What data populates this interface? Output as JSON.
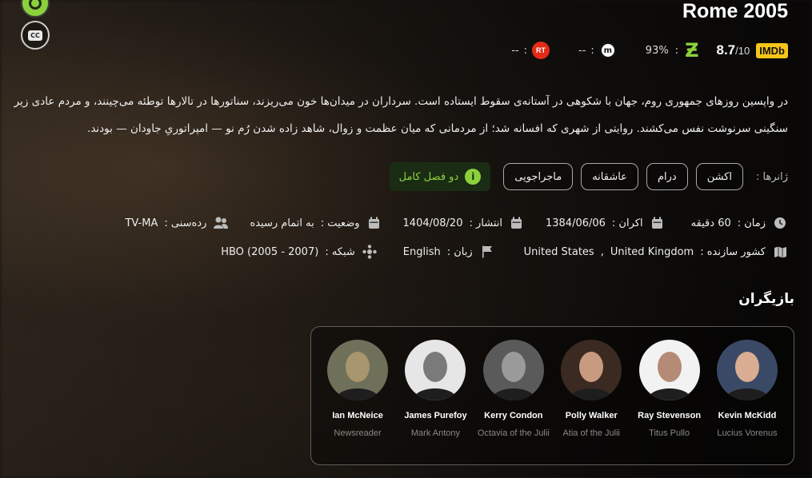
{
  "title": "Rome 2005",
  "ratings": {
    "rt_label": "RT",
    "rt_value": "--",
    "mc_value": "--",
    "pct_value": "93%",
    "imdb_score": "8.7",
    "imdb_max": "/10",
    "imdb_label": "IMDb"
  },
  "description": "در واپسین روزهای جمهوری روم، جهان با شکوهی در آستانه‌ی سقوط ایستاده است. سرداران در میدان‌ها خون می‌ریزند، سناتورها در تالارها توطئه می‌چینند، و مردم عادی زیر سنگینی سرنوشت نفس می‌کشند. روایتی از شهری که افسانه شد؛ از مردمانی که میان عظمت و زوال، شاهد زاده شدن رُم نو — امپراتوریِ جاودان — بودند.",
  "genres": {
    "label": "ژانرها :",
    "items": [
      "اکشن",
      "درام",
      "عاشقانه",
      "ماجراجویی"
    ]
  },
  "season_badge": "دو فصل کامل",
  "info": {
    "duration_label": "زمان :",
    "duration_value": "60 دقیقه",
    "premiere_label": "اکران :",
    "premiere_value": "1384/06/06",
    "release_label": "انتشار :",
    "release_value": "1404/08/20",
    "status_label": "وضعیت :",
    "status_value": "به اتمام رسیده",
    "age_label": "رده‌سنی :",
    "age_value": "TV-MA",
    "country_label": "کشور سازنده :",
    "country_1": "United Kingdom",
    "country_sep": ",",
    "country_2": "United States",
    "language_label": "زبان :",
    "language_value": "English",
    "network_label": "شبکه :",
    "network_value": "HBO (2005 - 2007)"
  },
  "cast_title": "بازیگران",
  "cast": [
    {
      "name": "Kevin McKidd",
      "role": "Lucius Vorenus",
      "bg": "#3a4a66",
      "skin": "#d9ad92"
    },
    {
      "name": "Ray Stevenson",
      "role": "Titus Pullo",
      "bg": "#f2f2f2",
      "skin": "#b58a76"
    },
    {
      "name": "Polly Walker",
      "role": "Atia of the Julii",
      "bg": "#3a2a22",
      "skin": "#c89a80"
    },
    {
      "name": "Kerry Condon",
      "role": "Octavia of the Julii",
      "bg": "#5a5a5a",
      "skin": "#9a9a9a"
    },
    {
      "name": "James Purefoy",
      "role": "Mark Antony",
      "bg": "#e6e6e6",
      "skin": "#7a7a7a"
    },
    {
      "name": "Ian McNeice",
      "role": "Newsreader",
      "bg": "#6e705a",
      "skin": "#a8966e"
    }
  ]
}
